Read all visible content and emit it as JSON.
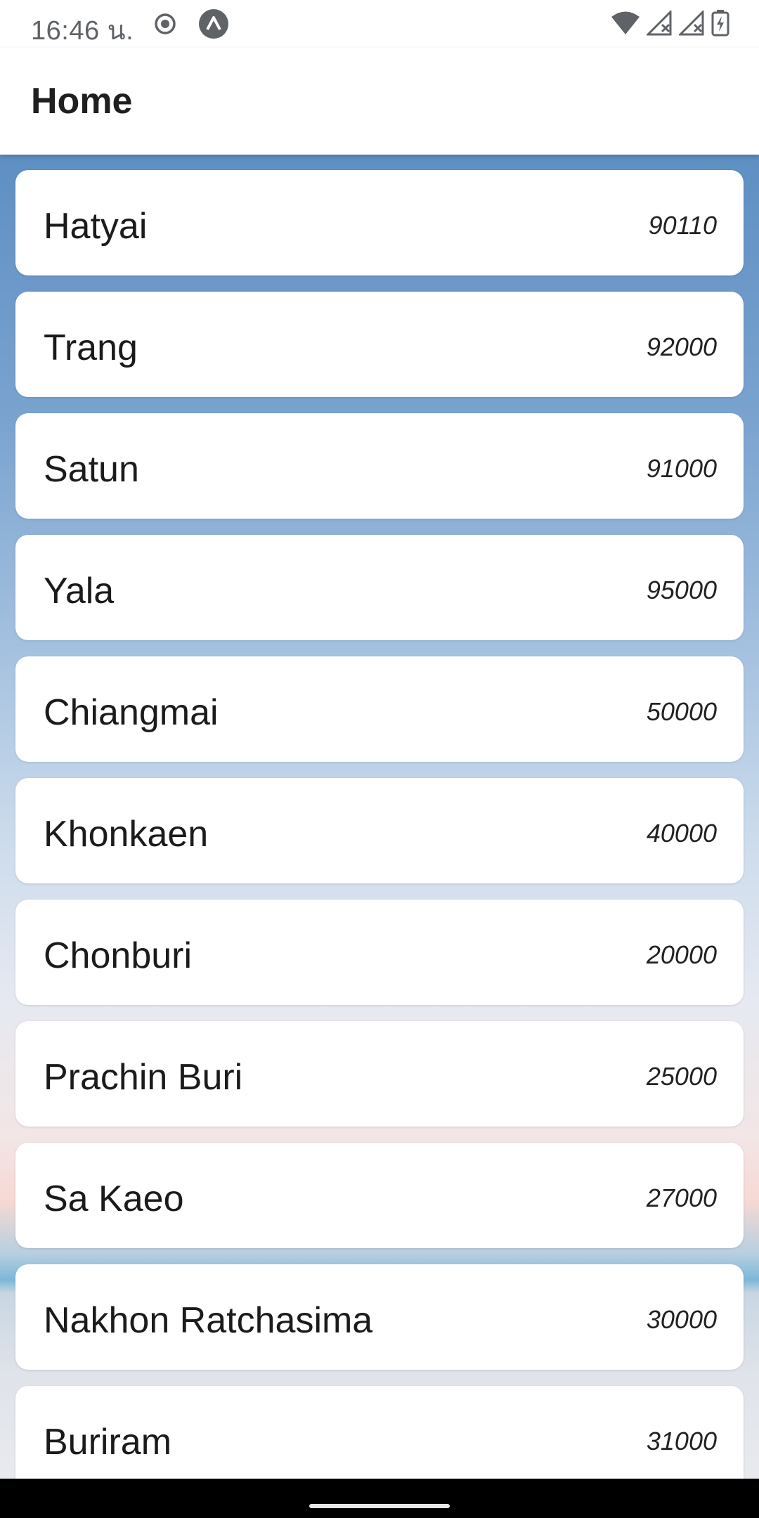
{
  "status_bar": {
    "time": "16:46 น.",
    "icons": [
      "record-icon",
      "app-notification-icon",
      "wifi-icon",
      "signal-icon",
      "signal-icon",
      "battery-icon"
    ]
  },
  "app_bar": {
    "title": "Home"
  },
  "items": [
    {
      "name": "Hatyai",
      "code": "90110"
    },
    {
      "name": "Trang",
      "code": "92000"
    },
    {
      "name": "Satun",
      "code": "91000"
    },
    {
      "name": "Yala",
      "code": "95000"
    },
    {
      "name": "Chiangmai",
      "code": "50000"
    },
    {
      "name": "Khonkaen",
      "code": "40000"
    },
    {
      "name": "Chonburi",
      "code": "20000"
    },
    {
      "name": "Prachin Buri",
      "code": "25000"
    },
    {
      "name": "Sa Kaeo",
      "code": "27000"
    },
    {
      "name": "Nakhon Ratchasima",
      "code": "30000"
    },
    {
      "name": "Buriram",
      "code": "31000"
    }
  ]
}
